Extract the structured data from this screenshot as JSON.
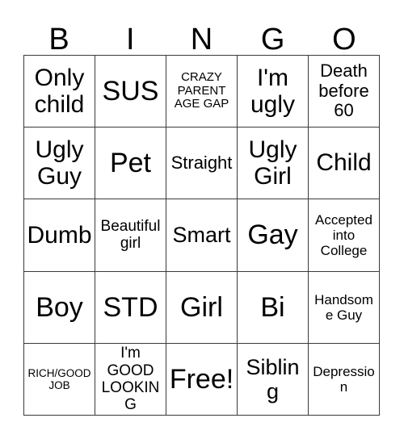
{
  "card": {
    "title": "BINGO",
    "header_letters": [
      "B",
      "I",
      "N",
      "G",
      "O"
    ],
    "border_color": "#3a3a3a",
    "text_color": "#000000",
    "background_color": "#ffffff",
    "columns": 5,
    "rows": 5,
    "free_space": "Free!",
    "free_space_position": {
      "row": 5,
      "column": 3
    },
    "cells": [
      [
        {
          "label": "Only child",
          "size": "xl"
        },
        {
          "label": "SUS",
          "size": "xxl"
        },
        {
          "label": "CRAZY PARENT AGE GAP",
          "size": "xxs"
        },
        {
          "label": "I'm ugly",
          "size": "xl"
        },
        {
          "label": "Death before 60",
          "size": "md"
        }
      ],
      [
        {
          "label": "Ugly Guy",
          "size": "xl"
        },
        {
          "label": "Pet",
          "size": "xxl"
        },
        {
          "label": "Straight",
          "size": "md"
        },
        {
          "label": "Ugly Girl",
          "size": "xl"
        },
        {
          "label": "Child",
          "size": "xl"
        }
      ],
      [
        {
          "label": "Dumb",
          "size": "xl"
        },
        {
          "label": "Beautiful girl",
          "size": "sm"
        },
        {
          "label": "Smart",
          "size": "lg"
        },
        {
          "label": "Gay",
          "size": "xxl"
        },
        {
          "label": "Accepted into College",
          "size": "xs"
        }
      ],
      [
        {
          "label": "Boy",
          "size": "xxl"
        },
        {
          "label": "STD",
          "size": "xxl"
        },
        {
          "label": "Girl",
          "size": "xxl"
        },
        {
          "label": "Bi",
          "size": "xxl"
        },
        {
          "label": "Handsome Guy",
          "size": "xs"
        }
      ],
      [
        {
          "label": "RICH/GOOD JOB",
          "size": "tiny"
        },
        {
          "label": "I'm GOOD LOOKING",
          "size": "sm"
        },
        {
          "label": "Free!",
          "size": "xxl"
        },
        {
          "label": "Sibling",
          "size": "lg"
        },
        {
          "label": "Depression",
          "size": "xs"
        }
      ]
    ]
  }
}
